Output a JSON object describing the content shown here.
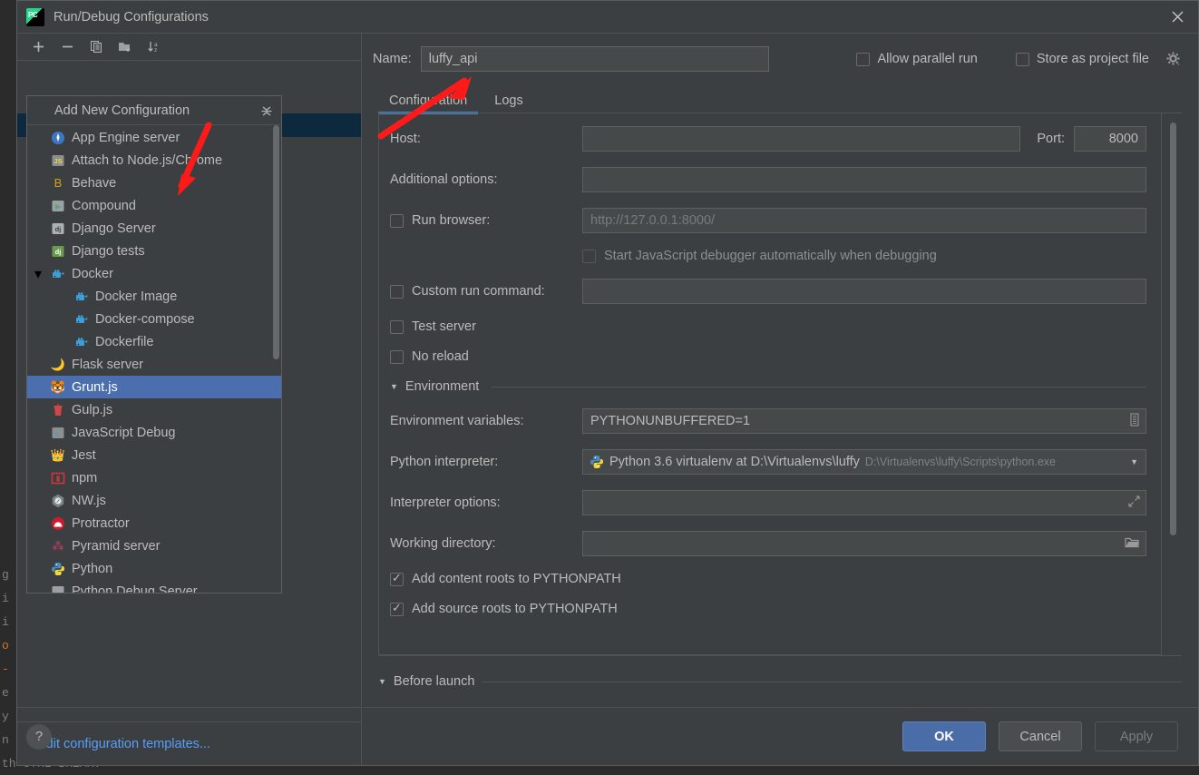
{
  "window": {
    "title": "Run/Debug Configurations",
    "logo_text": "PC",
    "close_icon": "close-icon"
  },
  "left_toolbar": {
    "icons": [
      {
        "name": "add-icon",
        "glyph": "+"
      },
      {
        "name": "remove-icon",
        "glyph": "−"
      },
      {
        "name": "copy-icon",
        "glyph": "❐"
      },
      {
        "name": "new-folder-icon",
        "glyph": "Ὄ1"
      },
      {
        "name": "sort-alphabetically-icon",
        "glyph": "↓"
      }
    ]
  },
  "popup": {
    "header": "Add New Configuration",
    "collapse_icon": "collapse-all-icon",
    "items": [
      {
        "label": "App Engine server",
        "icon": "app-engine-icon",
        "indent": false,
        "selected": false,
        "expander": ""
      },
      {
        "label": "Attach to Node.js/Chrome",
        "icon": "nodejs-attach-icon",
        "indent": false,
        "selected": false,
        "expander": ""
      },
      {
        "label": "Behave",
        "icon": "behave-icon",
        "indent": false,
        "selected": false,
        "expander": ""
      },
      {
        "label": "Compound",
        "icon": "compound-icon",
        "indent": false,
        "selected": false,
        "expander": ""
      },
      {
        "label": "Django Server",
        "icon": "django-server-icon",
        "indent": false,
        "selected": false,
        "expander": ""
      },
      {
        "label": "Django tests",
        "icon": "django-tests-icon",
        "indent": false,
        "selected": false,
        "expander": ""
      },
      {
        "label": "Docker",
        "icon": "docker-icon",
        "indent": false,
        "selected": false,
        "expander": "▾"
      },
      {
        "label": "Docker Image",
        "icon": "docker-icon",
        "indent": true,
        "selected": false,
        "expander": ""
      },
      {
        "label": "Docker-compose",
        "icon": "docker-icon",
        "indent": true,
        "selected": false,
        "expander": ""
      },
      {
        "label": "Dockerfile",
        "icon": "docker-icon",
        "indent": true,
        "selected": false,
        "expander": ""
      },
      {
        "label": "Flask server",
        "icon": "flask-icon",
        "indent": false,
        "selected": false,
        "expander": ""
      },
      {
        "label": "Grunt.js",
        "icon": "grunt-icon",
        "indent": false,
        "selected": true,
        "expander": ""
      },
      {
        "label": "Gulp.js",
        "icon": "gulp-icon",
        "indent": false,
        "selected": false,
        "expander": ""
      },
      {
        "label": "JavaScript Debug",
        "icon": "javascript-debug-icon",
        "indent": false,
        "selected": false,
        "expander": ""
      },
      {
        "label": "Jest",
        "icon": "jest-icon",
        "indent": false,
        "selected": false,
        "expander": ""
      },
      {
        "label": "npm",
        "icon": "npm-icon",
        "indent": false,
        "selected": false,
        "expander": ""
      },
      {
        "label": "NW.js",
        "icon": "nwjs-icon",
        "indent": false,
        "selected": false,
        "expander": ""
      },
      {
        "label": "Protractor",
        "icon": "protractor-icon",
        "indent": false,
        "selected": false,
        "expander": ""
      },
      {
        "label": "Pyramid server",
        "icon": "pyramid-icon",
        "indent": false,
        "selected": false,
        "expander": ""
      },
      {
        "label": "Python",
        "icon": "python-icon",
        "indent": false,
        "selected": false,
        "expander": ""
      },
      {
        "label": "Python Debug Server",
        "icon": "python-debug-server-icon",
        "indent": false,
        "selected": false,
        "expander": ""
      }
    ]
  },
  "left_footer": {
    "edit_templates_link": "Edit configuration templates..."
  },
  "right": {
    "name_label": "Name:",
    "name_value": "luffy_api",
    "allow_parallel_run": {
      "label": "Allow parallel run",
      "checked": false
    },
    "store_as_project_file": {
      "label": "Store as project file",
      "checked": false
    },
    "gear_icon": "gear-icon",
    "tabs": [
      {
        "label": "Configuration",
        "active": true
      },
      {
        "label": "Logs",
        "active": false
      }
    ],
    "fields": {
      "host_label": "Host:",
      "host_value": "",
      "port_label": "Port:",
      "port_value": "8000",
      "additional_options_label": "Additional options:",
      "additional_options_value": "",
      "run_browser_label": "Run browser:",
      "run_browser_checked": false,
      "run_browser_url": "http://127.0.0.1:8000/",
      "start_js_debugger_label": "Start JavaScript debugger automatically when debugging",
      "start_js_debugger_checked": false,
      "custom_run_command_label": "Custom run command:",
      "custom_run_command_checked": false,
      "custom_run_command_value": "",
      "test_server_label": "Test server",
      "test_server_checked": false,
      "no_reload_label": "No reload",
      "no_reload_checked": false,
      "environment_section": "Environment",
      "env_vars_label": "Environment variables:",
      "env_vars_value": "PYTHONUNBUFFERED=1",
      "env_vars_browse_icon": "edit-env-vars-icon",
      "python_interpreter_label": "Python interpreter:",
      "python_interpreter_value": "Python 3.6 virtualenv at D:\\Virtualenvs\\luffy",
      "python_interpreter_path": "D:\\Virtualenvs\\luffy\\Scripts\\python.exe",
      "interpreter_options_label": "Interpreter options:",
      "interpreter_options_value": "",
      "interpreter_expand_icon": "expand-editor-icon",
      "working_directory_label": "Working directory:",
      "working_directory_value": "",
      "working_directory_browse_icon": "folder-browse-icon",
      "add_content_roots_label": "Add content roots to PYTHONPATH",
      "add_content_roots_checked": true,
      "add_source_roots_label": "Add source roots to PYTHONPATH",
      "add_source_roots_checked": true
    },
    "before_launch": {
      "label": "Before launch",
      "expander": "▾"
    }
  },
  "footer": {
    "help_icon": "?",
    "ok_label": "OK",
    "cancel_label": "Cancel",
    "apply_label": "Apply"
  },
  "editor_background": {
    "lines": [
      "g",
      "i",
      "i",
      "o",
      "-",
      "e",
      "y",
      "n",
      "th CTRL-BREAK."
    ]
  },
  "colors": {
    "dialog_bg": "#3c3f41",
    "selection_blue": "#4b6eaf",
    "accent_blue": "#4a88c7",
    "link_blue": "#589df6",
    "annotation_red": "#ff1a1a"
  }
}
